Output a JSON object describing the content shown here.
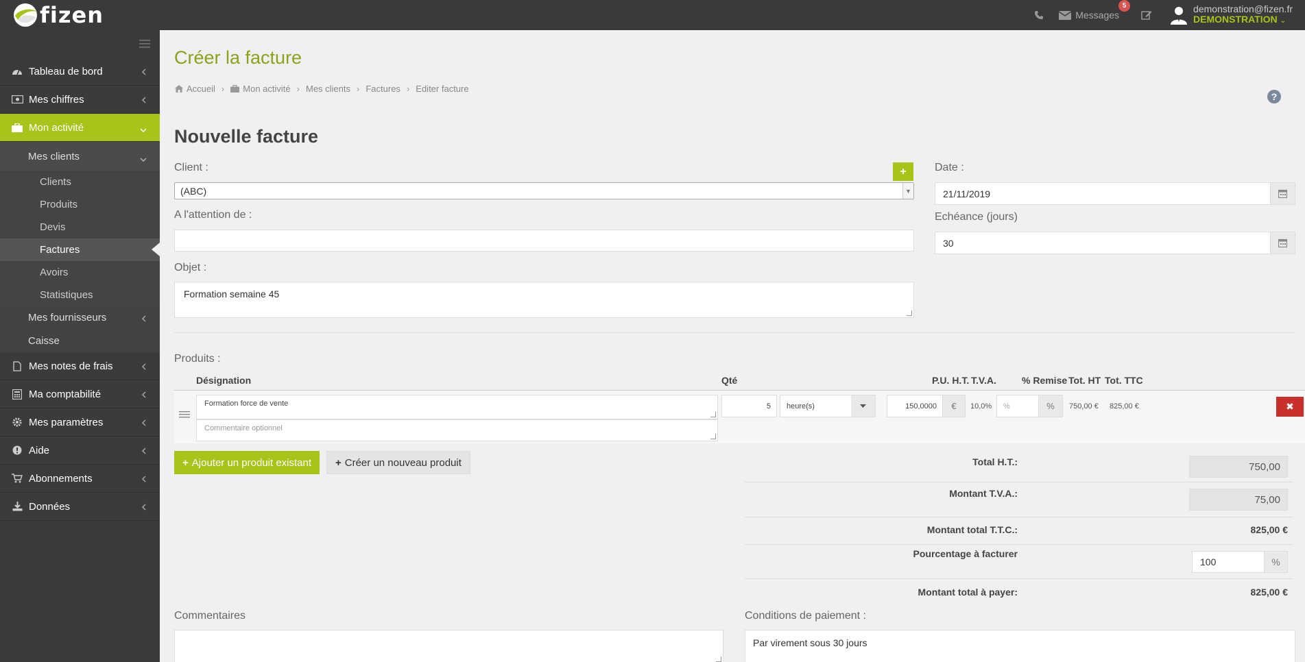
{
  "brand": {
    "name": "fizen"
  },
  "topbar": {
    "messages_label": "Messages",
    "messages_count": "5",
    "user_email": "demonstration@fizen.fr",
    "user_role": "DEMONSTRATION"
  },
  "sidebar": {
    "items": [
      {
        "label": "Tableau de bord",
        "icon": "dashboard-icon"
      },
      {
        "label": "Mes chiffres",
        "icon": "money-icon"
      },
      {
        "label": "Mon activité",
        "icon": "briefcase-icon"
      },
      {
        "label": "Mes notes de frais",
        "icon": "file-icon"
      },
      {
        "label": "Ma comptabilité",
        "icon": "calculator-icon"
      },
      {
        "label": "Mes paramètres",
        "icon": "gear-icon"
      },
      {
        "label": "Aide",
        "icon": "info-icon"
      },
      {
        "label": "Abonnements",
        "icon": "cart-icon"
      },
      {
        "label": "Données",
        "icon": "download-icon"
      }
    ],
    "mes_clients": "Mes clients",
    "clients_sub": [
      "Clients",
      "Produits",
      "Devis",
      "Factures",
      "Avoirs",
      "Statistiques"
    ],
    "mes_fournisseurs": "Mes fournisseurs",
    "caisse": "Caisse"
  },
  "page": {
    "title": "Créer la facture",
    "breadcrumb": [
      "Accueil",
      "Mon activité",
      "Mes clients",
      "Factures",
      "Editer facture"
    ],
    "section_title": "Nouvelle facture"
  },
  "form": {
    "client_label": "Client :",
    "client_value": "(ABC)",
    "attention_label": "A l'attention de :",
    "attention_value": "",
    "objet_label": "Objet :",
    "objet_value": "Formation semaine 45",
    "date_label": "Date :",
    "date_value": "21/11/2019",
    "echeance_label": "Echéance (jours)",
    "echeance_value": "30"
  },
  "products": {
    "label": "Produits :",
    "headers": {
      "designation": "Désignation",
      "qte": "Qté",
      "pu_ht": "P.U. H.T.",
      "tva": "T.V.A.",
      "remise": "% Remise",
      "tot_ht": "Tot. HT",
      "tot_ttc": "Tot. TTC"
    },
    "row": {
      "designation": "Formation force de vente",
      "comment_placeholder": "Commentaire optionnel",
      "qte": "5",
      "unit": "heure(s)",
      "pu": "150,0000",
      "currency": "€",
      "tva": "10,0%",
      "remise_placeholder": "%",
      "remise_suffix": "%",
      "tot_ht": "750,00 €",
      "tot_ttc": "825,00 €"
    },
    "add_existing": "Ajouter un produit existant",
    "create_new": "Créer un nouveau produit"
  },
  "totals": {
    "total_ht_label": "Total H.T.:",
    "total_ht_value": "750,00",
    "tva_label": "Montant T.V.A.:",
    "tva_value": "75,00",
    "ttc_label": "Montant total T.T.C.:",
    "ttc_value": "825,00 €",
    "pct_label": "Pourcentage à facturer",
    "pct_value": "100",
    "pct_suffix": "%",
    "pay_label": "Montant total à payer:",
    "pay_value": "825,00 €"
  },
  "bottom": {
    "commentaires_label": "Commentaires",
    "commentaires_value": "",
    "conditions_label": "Conditions de paiement :",
    "conditions_value": "Par virement sous 30 jours"
  },
  "colors": {
    "accent": "#a8c31a",
    "sidebar": "#3b3b3b",
    "topbar": "#3a3a3a",
    "danger": "#c9302c"
  }
}
